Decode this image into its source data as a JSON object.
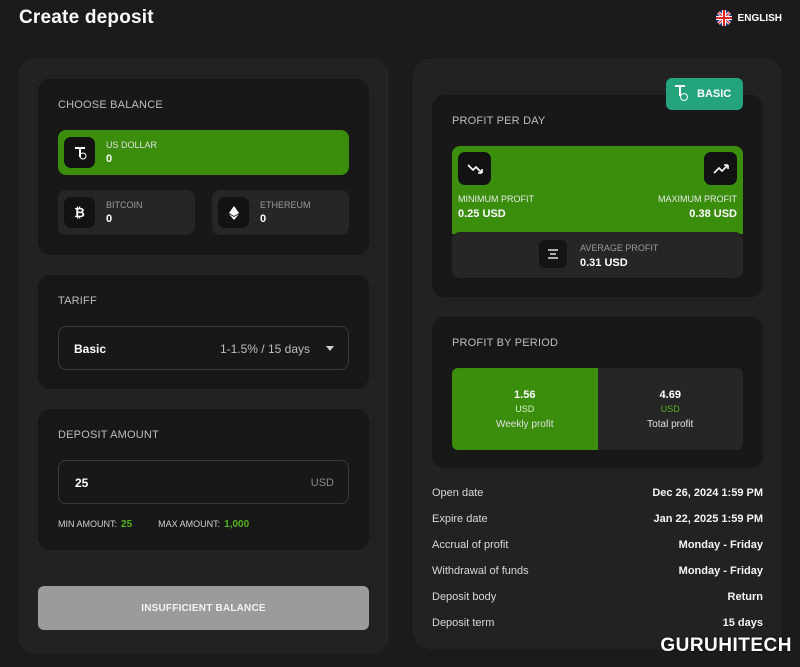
{
  "header": {
    "title": "Create deposit",
    "language": "ENGLISH"
  },
  "balance": {
    "title": "CHOOSE BALANCE",
    "items": [
      {
        "name": "US DOLLAR",
        "value": "0",
        "icon": "tether-icon",
        "active": true
      },
      {
        "name": "BITCOIN",
        "value": "0",
        "icon": "bitcoin-icon"
      },
      {
        "name": "ETHEREUM",
        "value": "0",
        "icon": "ethereum-icon"
      }
    ]
  },
  "tariff": {
    "title": "TARIFF",
    "selected_name": "Basic",
    "selected_range": "1-1.5% / 15 days"
  },
  "deposit": {
    "title": "DEPOSIT AMOUNT",
    "value": "25",
    "currency": "USD",
    "min_label": "MIN AMOUNT:",
    "min_value": "25",
    "max_label": "MAX AMOUNT:",
    "max_value": "1,000"
  },
  "submit_label": "INSUFFICIENT BALANCE",
  "plan_badge": "BASIC",
  "profit_per_day": {
    "title": "PROFIT PER DAY",
    "min_label": "MINIMUM PROFIT",
    "min_value": "0.25 USD",
    "max_label": "MAXIMUM PROFIT",
    "max_value": "0.38 USD",
    "avg_label": "AVERAGE PROFIT",
    "avg_value": "0.31 USD"
  },
  "profit_by_period": {
    "title": "PROFIT BY PERIOD",
    "cells": [
      {
        "value": "1.56",
        "unit": "USD",
        "label": "Weekly profit"
      },
      {
        "value": "4.69",
        "unit": "USD",
        "label": "Total profit"
      }
    ]
  },
  "details": [
    {
      "key": "Open date",
      "value": "Dec 26, 2024 1:59 PM"
    },
    {
      "key": "Expire date",
      "value": "Jan 22, 2025 1:59 PM"
    },
    {
      "key": "Accrual of profit",
      "value": "Monday - Friday"
    },
    {
      "key": "Withdrawal of funds",
      "value": "Monday - Friday"
    },
    {
      "key": "Deposit body",
      "value": "Return"
    },
    {
      "key": "Deposit term",
      "value": "15 days"
    }
  ],
  "watermark": "GURUHITECH",
  "colors": {
    "accent_green": "#3a8e0c",
    "badge_teal": "#23a47a",
    "background": "#1b1b1b"
  }
}
